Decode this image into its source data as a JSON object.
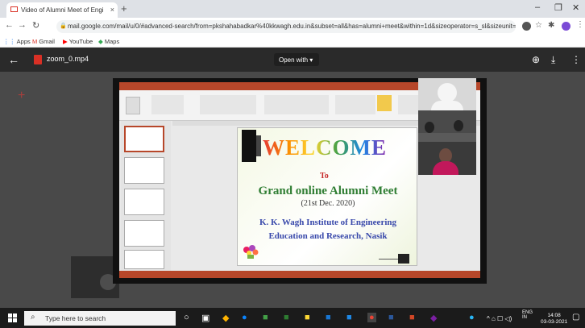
{
  "browser": {
    "tab_title": "Video of Alumni Meet of Engi",
    "url": "mail.google.com/mail/u/0/#advanced-search/from=pkshahabadkar%40kkwagh.edu.in&subset=all&has=alumni+meet&within=1d&sizeoperator=s_sl&sizeunit=s...",
    "bookmarks": [
      "Apps",
      "Gmail",
      "YouTube",
      "Maps"
    ]
  },
  "viewer": {
    "file_name": "zoom_0.mp4",
    "open_with_label": "Open with"
  },
  "slide": {
    "welcome": "WELCOME",
    "to": "To",
    "event": "Grand online Alumni Meet",
    "date": "(21st Dec. 2020)",
    "institute_line1": "K. K. Wagh Institute of Engineering",
    "institute_line2": "Education and Research, Nasik"
  },
  "taskbar": {
    "search_placeholder": "Type here to search",
    "lang_top": "ENG",
    "lang_bottom": "IN",
    "time": "14:08",
    "date": "03-03-2021"
  },
  "colors": {
    "accent_red": "#d93025",
    "ppt_red": "#b7472a"
  }
}
